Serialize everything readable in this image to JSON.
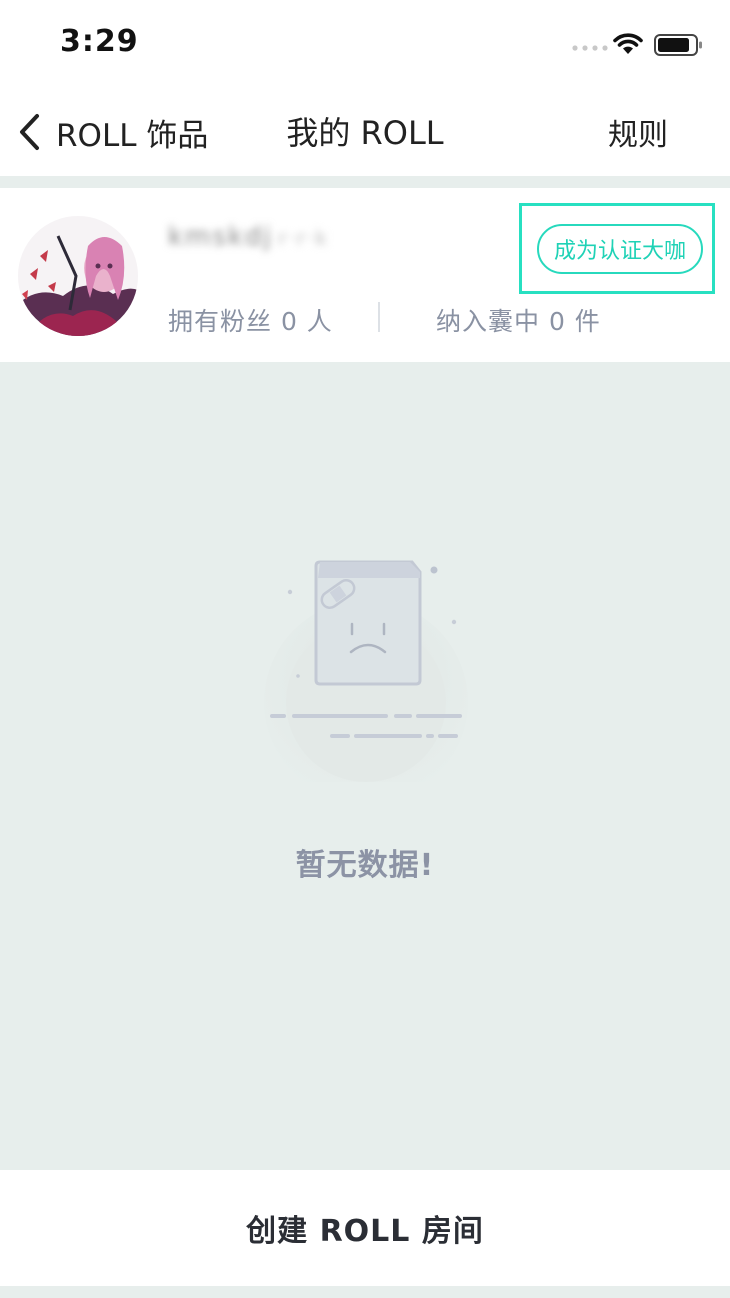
{
  "status_bar": {
    "time": "3:29",
    "icons": [
      "signal-dots-icon",
      "wifi-icon",
      "battery-icon"
    ]
  },
  "nav": {
    "back_label": "ROLL 饰品",
    "title": "我的 ROLL",
    "rules_label": "规则"
  },
  "profile": {
    "name": "kmskdj",
    "id": "r·r·k",
    "fans": "拥有粉丝 0 人",
    "items": "纳入囊中 0 件",
    "verify_label": "成为认证大咖"
  },
  "empty": {
    "text": "暂无数据!"
  },
  "bottom": {
    "create_label": "创建 ROLL 房间"
  },
  "colors": {
    "accent": "#27d9bd",
    "background": "#e7eeec",
    "muted_text": "#8a92a3"
  }
}
